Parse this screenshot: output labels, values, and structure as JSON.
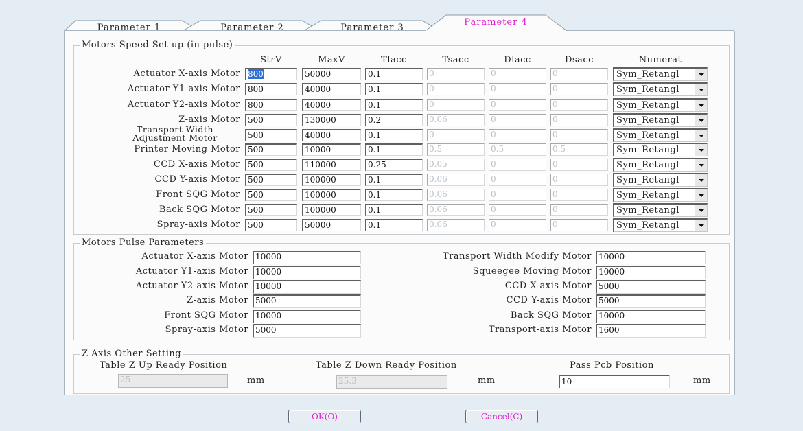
{
  "tabs": [
    "Parameter 1",
    "Parameter 2",
    "Parameter 3",
    "Parameter 4"
  ],
  "speed": {
    "legend": "Motors Speed Set-up (in pulse)",
    "headers": [
      "StrV",
      "MaxV",
      "Tlacc",
      "Tsacc",
      "Dlacc",
      "Dsacc",
      "Numerat"
    ],
    "rows": [
      {
        "label": "Actuator X-axis Motor",
        "strv": "800",
        "maxv": "50000",
        "tlacc": "0.1",
        "tsacc": "0",
        "dlacc": "0",
        "dsacc": "0",
        "numerat": "Sym_Retangl"
      },
      {
        "label": "Actuator Y1-axis Motor",
        "strv": "800",
        "maxv": "40000",
        "tlacc": "0.1",
        "tsacc": "0",
        "dlacc": "0",
        "dsacc": "0",
        "numerat": "Sym_Retangl"
      },
      {
        "label": "Actuator Y2-axis Motor",
        "strv": "800",
        "maxv": "40000",
        "tlacc": "0.1",
        "tsacc": "0",
        "dlacc": "0",
        "dsacc": "0",
        "numerat": "Sym_Retangl"
      },
      {
        "label": "Z-axis Motor",
        "strv": "500",
        "maxv": "130000",
        "tlacc": "0.2",
        "tsacc": "0.06",
        "dlacc": "0",
        "dsacc": "0",
        "numerat": "Sym_Retangl"
      },
      {
        "label": "Transport Width Adjustment Motor",
        "label_l1": "Transport Width",
        "label_l2": "Adjustment Motor",
        "strv": "500",
        "maxv": "40000",
        "tlacc": "0.1",
        "tsacc": "0",
        "dlacc": "0",
        "dsacc": "0",
        "numerat": "Sym_Retangl"
      },
      {
        "label": "Printer Moving Motor",
        "strv": "500",
        "maxv": "10000",
        "tlacc": "0.1",
        "tsacc": "0.5",
        "dlacc": "0.5",
        "dsacc": "0.5",
        "numerat": "Sym_Retangl"
      },
      {
        "label": "CCD X-axis Motor",
        "strv": "500",
        "maxv": "110000",
        "tlacc": "0.25",
        "tsacc": "0.05",
        "dlacc": "0",
        "dsacc": "0",
        "numerat": "Sym_Retangl"
      },
      {
        "label": "CCD Y-axis Motor",
        "strv": "500",
        "maxv": "100000",
        "tlacc": "0.1",
        "tsacc": "0.06",
        "dlacc": "0",
        "dsacc": "0",
        "numerat": "Sym_Retangl"
      },
      {
        "label": "Front SQG Motor",
        "strv": "500",
        "maxv": "100000",
        "tlacc": "0.1",
        "tsacc": "0.06",
        "dlacc": "0",
        "dsacc": "0",
        "numerat": "Sym_Retangl"
      },
      {
        "label": "Back SQG Motor",
        "strv": "500",
        "maxv": "100000",
        "tlacc": "0.1",
        "tsacc": "0.06",
        "dlacc": "0",
        "dsacc": "0",
        "numerat": "Sym_Retangl"
      },
      {
        "label": "Spray-axis Motor",
        "strv": "500",
        "maxv": "50000",
        "tlacc": "0.1",
        "tsacc": "0.06",
        "dlacc": "0",
        "dsacc": "0",
        "numerat": "Sym_Retangl"
      }
    ]
  },
  "pulse": {
    "legend": "Motors Pulse Parameters",
    "left": [
      {
        "label": "Actuator X-axis Motor",
        "value": "10000"
      },
      {
        "label": "Actuator Y1-axis Motor",
        "value": "10000"
      },
      {
        "label": "Actuator Y2-axis Motor",
        "value": "10000"
      },
      {
        "label": "Z-axis Motor",
        "value": "5000"
      },
      {
        "label": "Front SQG Motor",
        "value": "10000"
      },
      {
        "label": "Spray-axis Motor",
        "value": "5000"
      }
    ],
    "right": [
      {
        "label": "Transport Width Modify Motor",
        "value": "10000"
      },
      {
        "label": "Squeegee Moving Motor",
        "value": "10000"
      },
      {
        "label": "CCD X-axis Motor",
        "value": "5000"
      },
      {
        "label": "CCD Y-axis Motor",
        "value": "5000"
      },
      {
        "label": "Back SQG Motor",
        "value": "10000"
      },
      {
        "label": "Transport-axis Motor",
        "value": "1600"
      }
    ]
  },
  "zaxis": {
    "legend": "Z Axis Other Setting",
    "up_label": "Table Z Up Ready Position",
    "up_value": "25",
    "down_label": "Table Z Down Ready Position",
    "down_value": "25.3",
    "pass_label": "Pass Pcb Position",
    "pass_value": "10",
    "unit": "mm"
  },
  "buttons": {
    "ok": "OK(O)",
    "cancel": "Cancel(C)"
  },
  "colors": {
    "active_tab": "#e020d0",
    "selection": "#2f6fd6",
    "background": "#e4ecf4"
  }
}
